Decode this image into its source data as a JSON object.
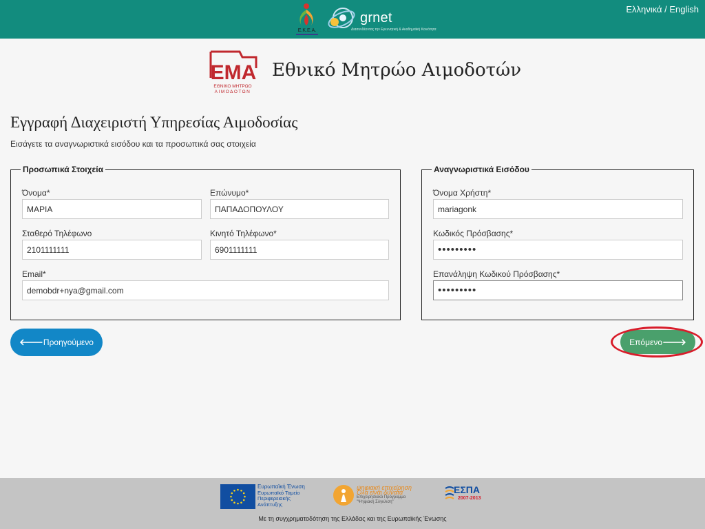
{
  "header": {
    "language_switch": {
      "el": "Ελληνικά",
      "separator": " / ",
      "en": "English"
    },
    "grnet_name": "grnet",
    "grnet_tagline": "Διασυνδέοντας την Ερευνητική & Ακαδημαϊκή Κοινότητα",
    "esda_label": "Ε.Κ.Ε.Α."
  },
  "brand": {
    "logo_text": "ΕΜΑ",
    "logo_sub1": "ΕΘΝΙΚΟ ΜΗΤΡΩΟ",
    "logo_sub2": "ΑΙΜΟΔΟΤΩΝ",
    "title": "Εθνικό Μητρώο Αιμοδοτών",
    "brand_color": "#c0282e"
  },
  "page": {
    "title": "Εγγραφή Διαχειριστή Υπηρεσίας Αιμοδοσίας",
    "subtitle": "Εισάγετε τα αναγνωριστικά εισόδου και τα προσωπικά σας στοιχεία"
  },
  "personal": {
    "legend": "Προσωπικά Στοιχεία",
    "first_name": {
      "label": "Όνομα*",
      "value": "ΜΑΡΙΑ"
    },
    "last_name": {
      "label": "Επώνυμο*",
      "value": "ΠΑΠΑΔΟΠΟΥΛΟΥ"
    },
    "landline": {
      "label": "Σταθερό Τηλέφωνο",
      "value": "2101111111"
    },
    "mobile": {
      "label": "Κινητό Τηλέφωνο*",
      "value": "6901111111"
    },
    "email": {
      "label": "Email*",
      "value": "demobdr+nya@gmail.com"
    }
  },
  "credentials": {
    "legend": "Αναγνωριστικά Εισόδου",
    "username": {
      "label": "Όνομα Χρήστη*",
      "value": "mariagonk"
    },
    "password": {
      "label": "Κωδικός Πρόσβασης*",
      "value": "•••••••••"
    },
    "password_repeat": {
      "label": "Επανάληψη Κωδικού Πρόσβασης*",
      "value": "•••••••••"
    }
  },
  "buttons": {
    "prev": {
      "icon": "arrow-left-icon",
      "label": "Προηγούμενο",
      "color": "#1287c7"
    },
    "next": {
      "icon": "arrow-right-icon",
      "label": "Επόμενο",
      "color": "#4aa06c"
    },
    "highlight_color": "#d81c2a"
  },
  "footer": {
    "eu_line1": "Ευρωπαϊκή Ένωση",
    "eu_line2": "Ευρωπαϊκό Ταμείο",
    "eu_line3": "Περιφερειακής",
    "eu_line4": "Ανάπτυξης",
    "digital_line1": "ψηφιακή επιχείρηση",
    "digital_line2": "Όλα είναι δυνατά",
    "digital_line3": "Επιχειρησιακό Πρόγραμμα",
    "digital_line4": "\"Ψηφιακή Σύγκλιση\"",
    "espa_label": "ΕΣΠΑ",
    "espa_years": "2007-2013",
    "credit": "Με τη συγχρηματοδότηση της Ελλάδας και της Ευρωπαϊκής Ένωσης"
  }
}
